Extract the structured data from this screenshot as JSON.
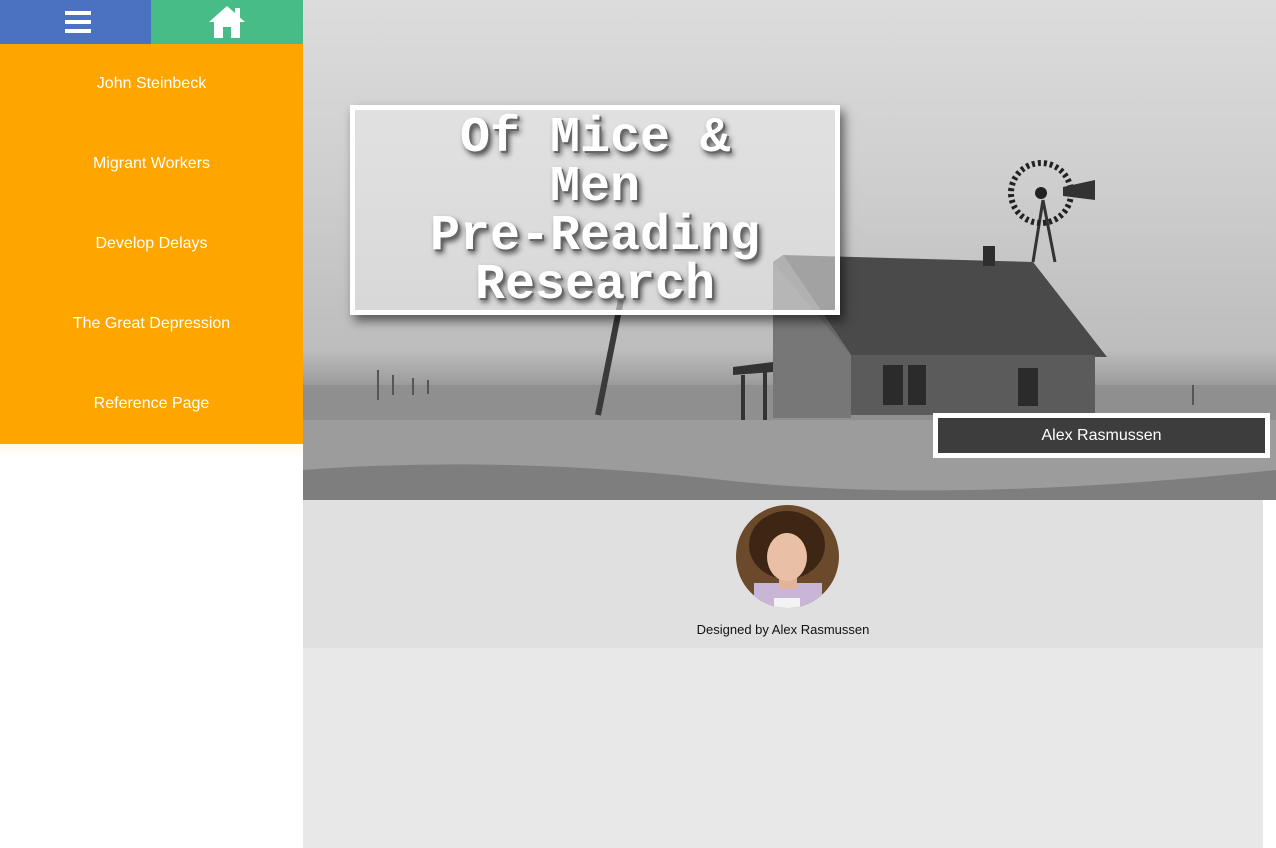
{
  "toolbar": {
    "menu_icon": "hamburger-menu-icon",
    "home_icon": "home-icon",
    "menu_color": "#4a72c0",
    "home_color": "#47bc86"
  },
  "nav": {
    "background": "#ffa500",
    "items": [
      {
        "label": "John Steinbeck"
      },
      {
        "label": "Migrant Workers"
      },
      {
        "label": "Develop Delays"
      },
      {
        "label": "The Great Depression"
      },
      {
        "label": "Reference Page"
      }
    ]
  },
  "hero": {
    "title_lines": [
      "Of Mice &",
      "Men",
      "Pre-Reading",
      "Research"
    ],
    "author_label": "Alex Rasmussen"
  },
  "footer": {
    "credit": "Designed by Alex Rasmussen"
  }
}
